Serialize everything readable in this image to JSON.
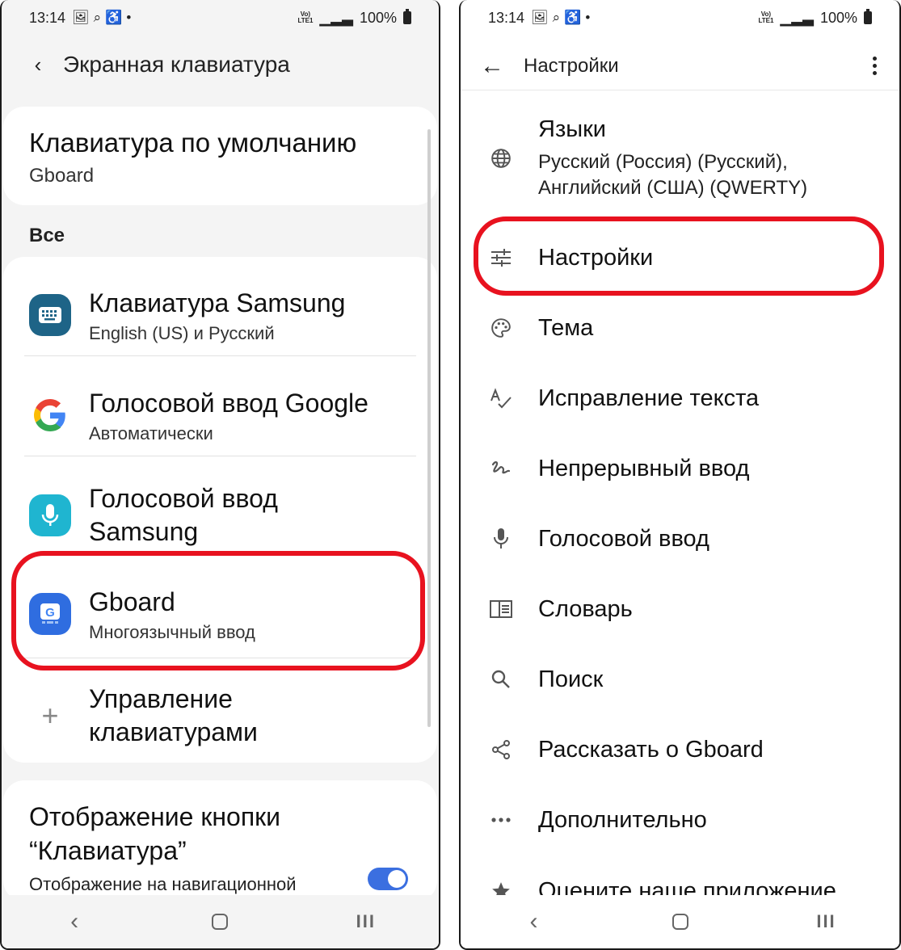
{
  "left_phone": {
    "status": {
      "time": "13:14",
      "icons": [
        "image-icon",
        "search-icon",
        "accessibility-icon",
        "dot-icon"
      ],
      "network": "VoLTE LTE1",
      "battery": "100%"
    },
    "header": {
      "title": "Экранная клавиатура"
    },
    "default_keyboard": {
      "title": "Клавиатура по умолчанию",
      "value": "Gboard"
    },
    "section_label": "Все",
    "keyboards": [
      {
        "title": "Клавиатура Samsung",
        "subtitle": "English (US) и Русский",
        "icon": "samsung-keyboard-icon"
      },
      {
        "title": "Голосовой ввод Google",
        "subtitle": "Автоматически",
        "icon": "google-g-icon"
      },
      {
        "title": "Голосовой ввод Samsung",
        "subtitle": "",
        "icon": "samsung-voice-icon"
      },
      {
        "title": "Gboard",
        "subtitle": "Многоязычный ввод",
        "icon": "gboard-icon"
      }
    ],
    "manage": {
      "label": "Управление клавиатурами",
      "icon": "plus-icon"
    },
    "display_button": {
      "title": "Отображение кнопки “Клавиатура”",
      "subtitle": "Отображение на навигационной",
      "toggle_on": true
    }
  },
  "right_phone": {
    "status": {
      "time": "13:14",
      "icons": [
        "image-icon",
        "search-icon",
        "accessibility-icon",
        "dot-icon"
      ],
      "network": "VoLTE LTE1",
      "battery": "100%"
    },
    "header": {
      "title": "Настройки"
    },
    "languages": {
      "title": "Языки",
      "value": "Русский (Россия) (Русский), Английский (США) (QWERTY)"
    },
    "items": [
      {
        "label": "Настройки",
        "icon": "sliders-icon"
      },
      {
        "label": "Тема",
        "icon": "palette-icon"
      },
      {
        "label": "Исправление текста",
        "icon": "spellcheck-icon"
      },
      {
        "label": "Непрерывный ввод",
        "icon": "glide-typing-icon"
      },
      {
        "label": "Голосовой ввод",
        "icon": "microphone-icon"
      },
      {
        "label": "Словарь",
        "icon": "dictionary-icon"
      },
      {
        "label": "Поиск",
        "icon": "search-icon"
      },
      {
        "label": "Рассказать о Gboard",
        "icon": "share-icon"
      },
      {
        "label": "Дополнительно",
        "icon": "more-horizontal-icon"
      },
      {
        "label": "Оцените наше приложение",
        "icon": "star-icon"
      }
    ]
  },
  "colors": {
    "highlight": "#e8121f",
    "toggle": "#3b6fe0"
  }
}
